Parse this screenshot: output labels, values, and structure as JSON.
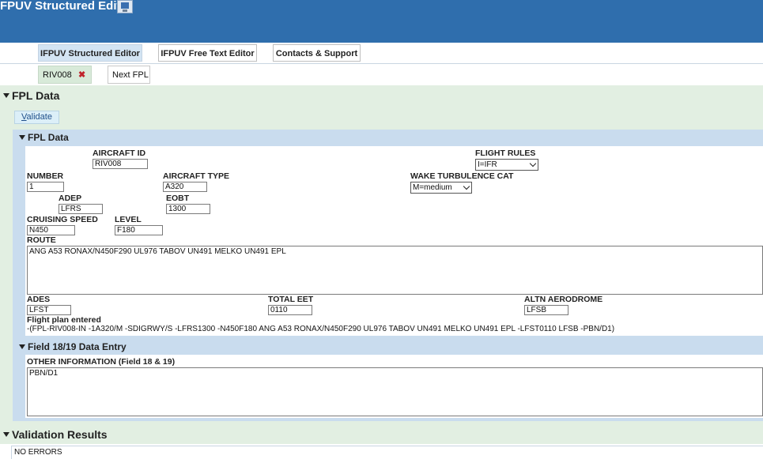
{
  "app": {
    "title": "FPUV Structured Editor",
    "title_icon": "monitor-icon"
  },
  "tabs": [
    {
      "label": "IFPUV Structured Editor",
      "active": true
    },
    {
      "label": "IFPUV Free Text Editor",
      "active": false
    },
    {
      "label": "Contacts & Support",
      "active": false
    }
  ],
  "subtabs": [
    {
      "label": "RIV008",
      "active": true,
      "close_icon": "close-icon"
    },
    {
      "label": "Next FPL",
      "active": false
    }
  ],
  "section": {
    "title": "FPL Data",
    "validate_label_first": "V",
    "validate_label_rest": "alidate"
  },
  "fpl": {
    "title": "FPL Data",
    "aircraft_id": {
      "label": "AIRCRAFT ID",
      "value": "RIV008"
    },
    "flight_rules": {
      "label": "FLIGHT RULES",
      "value": "I=IFR"
    },
    "number": {
      "label": "NUMBER",
      "value": "1"
    },
    "aircraft_type": {
      "label": "AIRCRAFT TYPE",
      "value": "A320"
    },
    "wake": {
      "label": "WAKE TURBULENCE CAT",
      "value": "M=medium"
    },
    "adep": {
      "label": "ADEP",
      "value": "LFRS"
    },
    "eobt": {
      "label": "EOBT",
      "value": "1300"
    },
    "speed": {
      "label": "CRUISING SPEED",
      "value": "N450"
    },
    "level": {
      "label": "LEVEL",
      "value": "F180"
    },
    "route": {
      "label": "ROUTE",
      "value": "ANG A53 RONAX/N450F290 UL976 TABOV UN491 MELKO UN491 EPL"
    },
    "ades": {
      "label": "ADES",
      "value": "LFST"
    },
    "total_eet": {
      "label": "TOTAL EET",
      "value": "0110"
    },
    "altn": {
      "label": "ALTN AERODROME",
      "value": "LFSB"
    },
    "entered_label": "Flight plan entered",
    "entered_text": "-(FPL-RIV008-IN -1A320/M -SDIGRWY/S -LFRS1300 -N450F180 ANG A53 RONAX/N450F290 UL976 TABOV UN491 MELKO UN491 EPL -LFST0110 LFSB -PBN/D1)"
  },
  "field18": {
    "title": "Field 18/19 Data Entry",
    "other_label": "OTHER INFORMATION (Field 18 & 19)",
    "other_value": "PBN/D1"
  },
  "validation": {
    "title": "Validation Results",
    "status": "NO ERRORS"
  },
  "colors": {
    "header": "#2f6ead",
    "section_bg": "#e2efe2",
    "inner_bg": "#c9dcee",
    "close": "#c0232b"
  }
}
